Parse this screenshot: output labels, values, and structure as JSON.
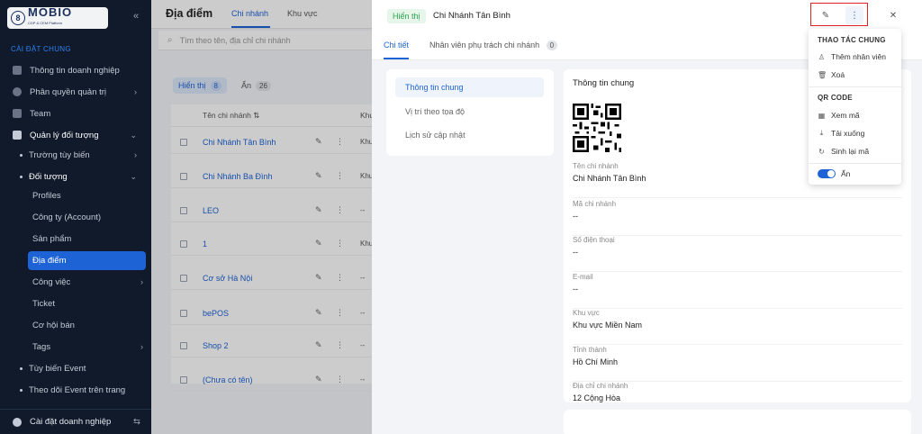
{
  "sidebar": {
    "logo_text": "MOBIO",
    "logo_sub": "CDP & CEM Platform",
    "section_title": "CÀI ĐẶT CHUNG",
    "items": [
      {
        "label": "Thông tin doanh nghiệp"
      },
      {
        "label": "Phân quyền quản trị"
      },
      {
        "label": "Team"
      },
      {
        "label": "Quản lý đối tượng"
      }
    ],
    "sub_items": [
      {
        "label": "Trường tùy biến"
      },
      {
        "label": "Đối tượng"
      }
    ],
    "object_items": [
      {
        "label": "Profiles"
      },
      {
        "label": "Công ty (Account)"
      },
      {
        "label": "Sản phẩm"
      },
      {
        "label": "Địa điểm"
      },
      {
        "label": "Công việc"
      },
      {
        "label": "Ticket"
      },
      {
        "label": "Cơ hội bán"
      },
      {
        "label": "Tags"
      }
    ],
    "extra_items": [
      {
        "label": "Tùy biến Event"
      },
      {
        "label": "Theo dõi Event trên trang"
      }
    ],
    "bottom_label": "Cài đặt doanh nghiệp"
  },
  "list": {
    "title": "Địa điểm",
    "tabs": [
      "Chi nhánh",
      "Khu vực"
    ],
    "search_placeholder": "Tìm theo tên, địa chỉ chi nhánh",
    "filter_shown": {
      "label": "Hiển thị",
      "count": "8"
    },
    "filter_hidden": {
      "label": "Ẩn",
      "count": "26"
    },
    "column_name": "Tên chi nhánh",
    "column_area": "Khu",
    "rows": [
      {
        "name": "Chi Nhánh Tân Bình",
        "area": "Khu"
      },
      {
        "name": "Chi Nhánh Ba Đình",
        "area": "Khu"
      },
      {
        "name": "LEO",
        "area": "--"
      },
      {
        "name": "1",
        "area": "Khu"
      },
      {
        "name": "Cơ sở Hà Nội",
        "area": "--"
      },
      {
        "name": "bePOS",
        "area": "--"
      },
      {
        "name": "Shop 2",
        "area": "--"
      },
      {
        "name": "(Chưa có tên)",
        "area": "--"
      }
    ]
  },
  "panel": {
    "status_badge": "Hiển thị",
    "title": "Chi Nhánh Tân Bình",
    "tabs": [
      {
        "label": "Chi tiết"
      },
      {
        "label": "Nhân viên phụ trách chi nhánh",
        "count": "0"
      }
    ],
    "nav": [
      "Thông tin chung",
      "Vị trí theo tọa độ",
      "Lịch sử cập nhật"
    ],
    "card_title": "Thông tin chung",
    "fields": [
      {
        "label": "Tên chi nhánh",
        "value": "Chi Nhánh Tân Bình"
      },
      {
        "label": "Mã chi nhánh",
        "value": "--"
      },
      {
        "label": "Số điện thoại",
        "value": "--"
      },
      {
        "label": "E-mail",
        "value": "--"
      },
      {
        "label": "Khu vực",
        "value": "Khu vực Miền Nam"
      },
      {
        "label": "Tỉnh thành",
        "value": "Hồ Chí Minh"
      },
      {
        "label": "Địa chỉ chi nhánh",
        "value": "12 Cộng Hòa"
      }
    ]
  },
  "menu": {
    "group_general": "THAO TÁC CHUNG",
    "add_staff": "Thêm nhân viên",
    "delete": "Xoá",
    "group_qr": "QR CODE",
    "view_code": "Xem mã",
    "download": "Tải xuống",
    "regenerate": "Sinh lại mã",
    "hide_toggle": "Ẩn"
  },
  "colors": {
    "accent": "#1e63d6",
    "sidebar_bg": "#101a2b",
    "success": "#2da44e",
    "highlight": "#e02424"
  }
}
